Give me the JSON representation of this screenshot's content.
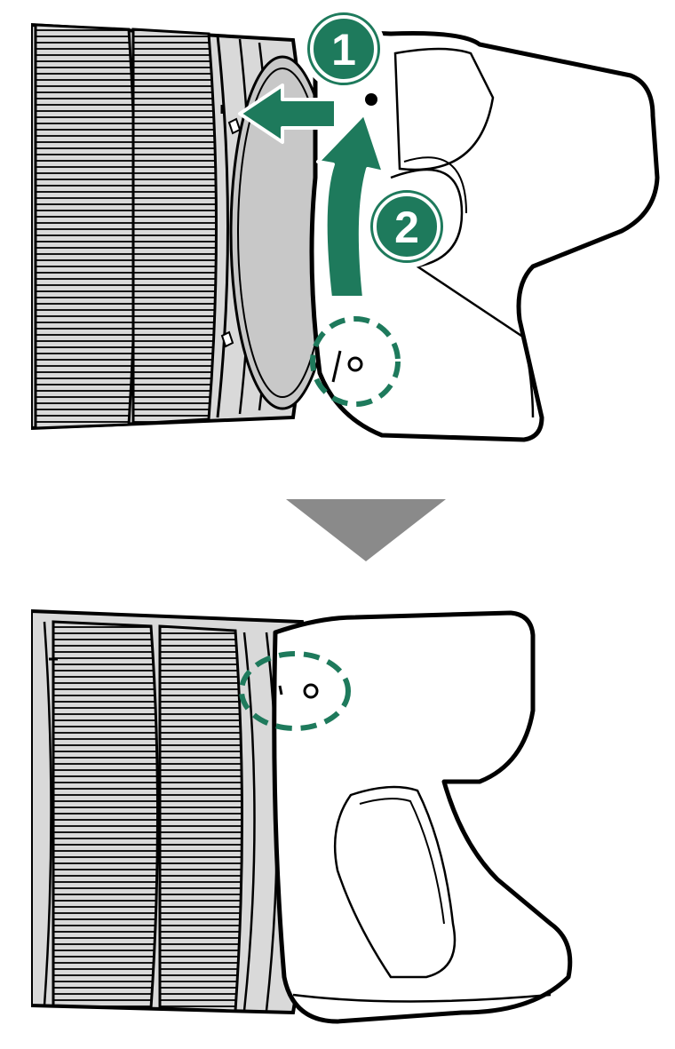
{
  "steps": [
    {
      "number": "1"
    },
    {
      "number": "2"
    }
  ],
  "colors": {
    "accent": "#1e7a5c",
    "indicator": "#8a8a8a",
    "lens_light": "#d9d9d9",
    "lens_mid": "#bdbdbd",
    "outline": "#000000",
    "background": "#ffffff"
  },
  "icons": {
    "arrow_left": "arrow-left-icon",
    "arrow_curved_up": "arrow-curved-up-icon",
    "arrow_down": "triangle-down-icon",
    "alignment_circle": "dashed-circle-icon"
  }
}
